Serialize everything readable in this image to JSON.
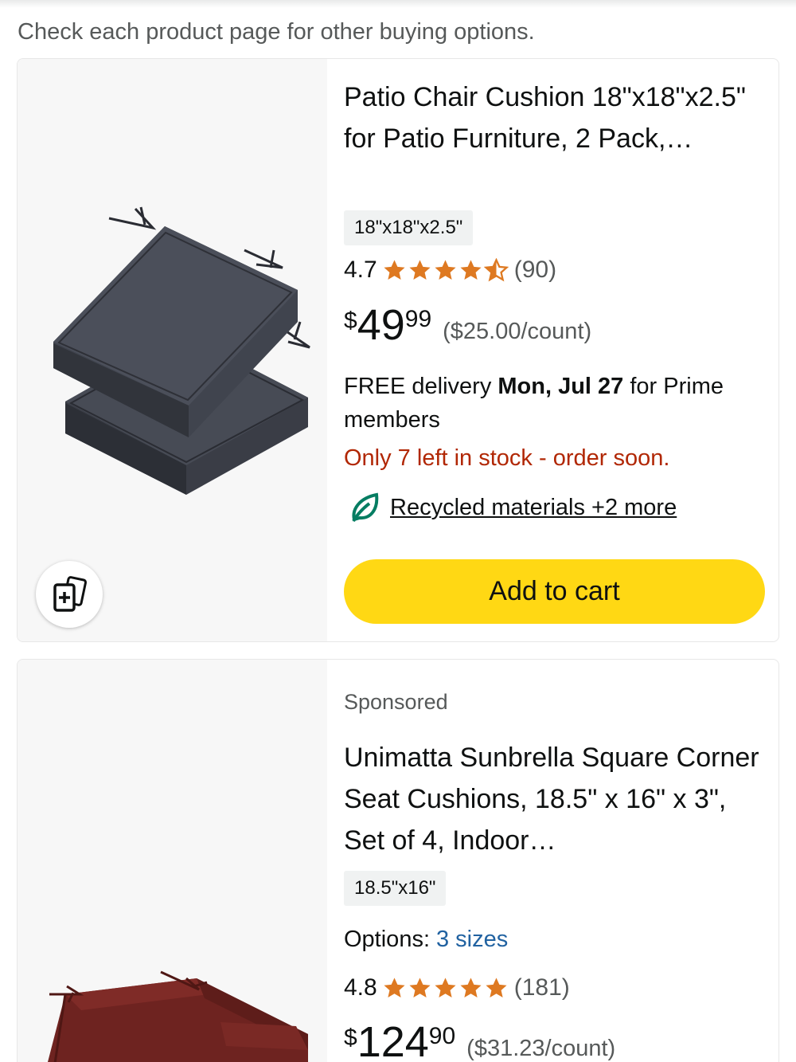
{
  "notice": "Check each product page for other buying options.",
  "colors": {
    "cart": "#ffd814",
    "star": "#de7921",
    "stock": "#b12704",
    "link": "#2162a1",
    "eco": "#067d62"
  },
  "products": [
    {
      "image_icon": "gray-square-cushions-image",
      "title": "Patio Chair Cushion 18\"x18\"x2.5\" for Patio Furniture, 2 Pack,…",
      "size": "18\"x18\"x2.5\"",
      "rating": "4.7",
      "stars": 4.7,
      "rating_count": "(90)",
      "price_symbol": "$",
      "price_whole": "49",
      "price_fraction": "99",
      "unit_price": "($25.00/count)",
      "delivery_prefix": "FREE delivery ",
      "delivery_date": "Mon, Jul 27",
      "delivery_suffix": " for Prime members",
      "stock": "Only 7 left in stock - order soon.",
      "eco_icon": "leaf-icon",
      "eco_text": "Recycled materials +2 more",
      "cart_label": "Add to cart",
      "compare_icon": "add-to-compare-icon"
    },
    {
      "image_icon": "red-square-cushions-image",
      "sponsored": "Sponsored",
      "title": "Unimatta Sunbrella Square Corner Seat Cushions, 18.5\" x 16\" x 3\", Set of 4, Indoor…",
      "size": "18.5\"x16\"",
      "options_label": "Options:",
      "options_value": "3 sizes",
      "rating": "4.8",
      "stars": 4.8,
      "rating_count": "(181)",
      "price_symbol": "$",
      "price_whole": "124",
      "price_fraction": "90",
      "unit_price": "($31.23/count)"
    }
  ]
}
